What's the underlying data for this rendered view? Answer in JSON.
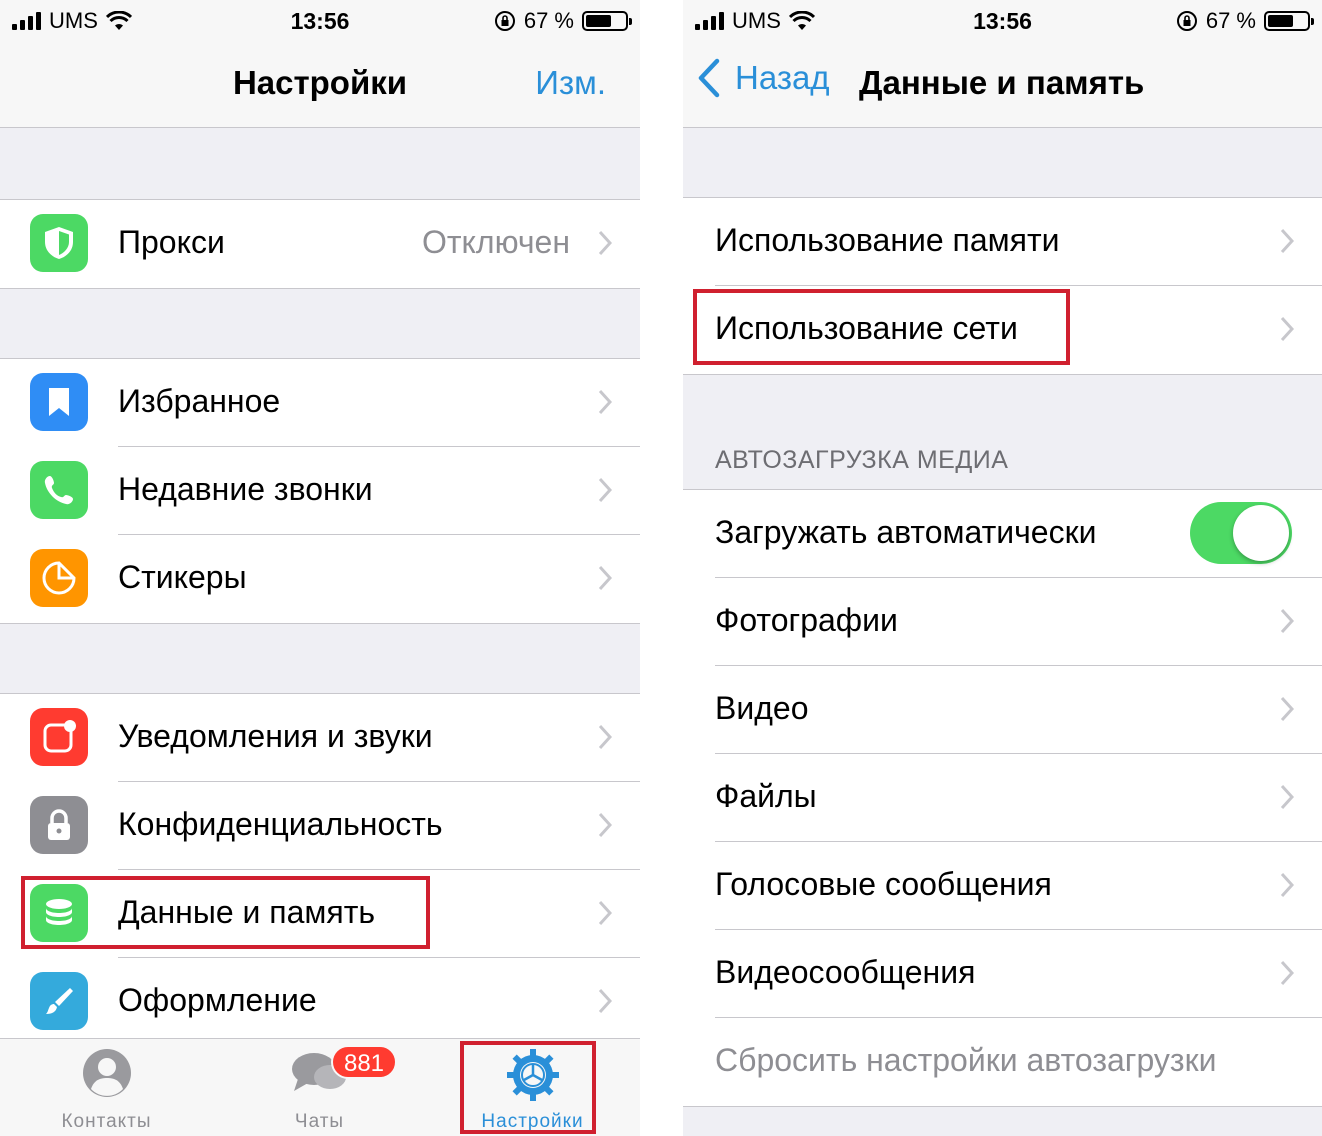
{
  "status": {
    "carrier": "UMS",
    "time": "13:56",
    "battery": "67 %"
  },
  "left": {
    "nav": {
      "title": "Настройки",
      "edit": "Изм."
    },
    "proxy": {
      "label": "Прокси",
      "value": "Отключен"
    },
    "group2": [
      {
        "label": "Избранное",
        "icon": "bookmark-icon",
        "color": "#2f8df5"
      },
      {
        "label": "Недавние звонки",
        "icon": "phone-icon",
        "color": "#4cd964"
      },
      {
        "label": "Стикеры",
        "icon": "sticker-icon",
        "color": "#ff9500"
      }
    ],
    "group3": [
      {
        "label": "Уведомления и звуки",
        "icon": "notification-icon",
        "color": "#ff3b30"
      },
      {
        "label": "Конфиденциальность",
        "icon": "lock-icon",
        "color": "#8e8e93"
      },
      {
        "label": "Данные и память",
        "icon": "database-icon",
        "color": "#4cd964"
      },
      {
        "label": "Оформление",
        "icon": "brush-icon",
        "color": "#34aadc"
      }
    ],
    "tabs": [
      {
        "label": "Контакты",
        "icon": "contacts-icon"
      },
      {
        "label": "Чаты",
        "icon": "chats-icon",
        "badge": "881"
      },
      {
        "label": "Настройки",
        "icon": "settings-gear-icon"
      }
    ]
  },
  "right": {
    "nav": {
      "back": "Назад",
      "title": "Данные и память"
    },
    "group1": [
      {
        "label": "Использование памяти"
      },
      {
        "label": "Использование сети"
      }
    ],
    "section_header": "АВТОЗАГРУЗКА МЕДИА",
    "group2": [
      {
        "label": "Загружать автоматически",
        "toggle_on": true
      },
      {
        "label": "Фотографии"
      },
      {
        "label": "Видео"
      },
      {
        "label": "Файлы"
      },
      {
        "label": "Голосовые сообщения"
      },
      {
        "label": "Видеосообщения"
      },
      {
        "label": "Сбросить настройки автозагрузки"
      }
    ]
  },
  "colors": {
    "accent": "#2a8fd8",
    "highlight": "#d0202f",
    "toggle": "#4cd964",
    "badge": "#ff3b30"
  }
}
